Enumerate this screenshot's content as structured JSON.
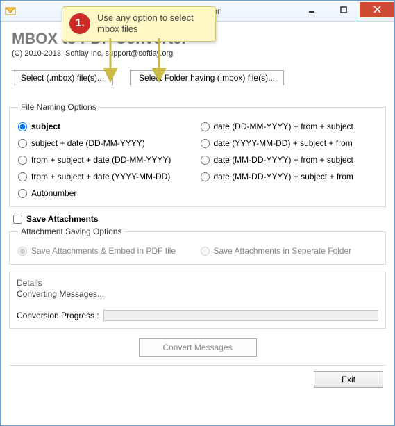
{
  "titlebar": {
    "text": "0 -  Licensed Version"
  },
  "callout": {
    "num": "1.",
    "text": "Use any option to select mbox files"
  },
  "page_title": "MBOX to PDF Converter",
  "copyright": "(C) 2010-2013, Softlay Inc, support@softlay.org",
  "buttons": {
    "select_mbox": "Select (.mbox) file(s)...",
    "select_folder": "Select Folder having (.mbox) file(s)...",
    "convert": "Convert Messages",
    "exit": "Exit"
  },
  "file_naming": {
    "legend": "File Naming Options",
    "options": [
      "subject",
      "date (DD-MM-YYYY) + from + subject",
      "subject + date (DD-MM-YYYY)",
      "date (YYYY-MM-DD) + subject + from",
      "from + subject + date (DD-MM-YYYY)",
      "date (MM-DD-YYYY) + from + subject",
      "from + subject + date (YYYY-MM-DD)",
      "date (MM-DD-YYYY) + subject + from",
      "Autonumber"
    ],
    "selected_index": 0
  },
  "save_attachments_label": "Save Attachments",
  "attachment_options": {
    "legend": "Attachment Saving Options",
    "opt1": "Save Attachments & Embed in PDF file",
    "opt2": "Save Attachments in Seperate Folder"
  },
  "details": {
    "legend": "Details",
    "converting": "Converting Messages...",
    "progress_label": "Conversion Progress  :"
  }
}
